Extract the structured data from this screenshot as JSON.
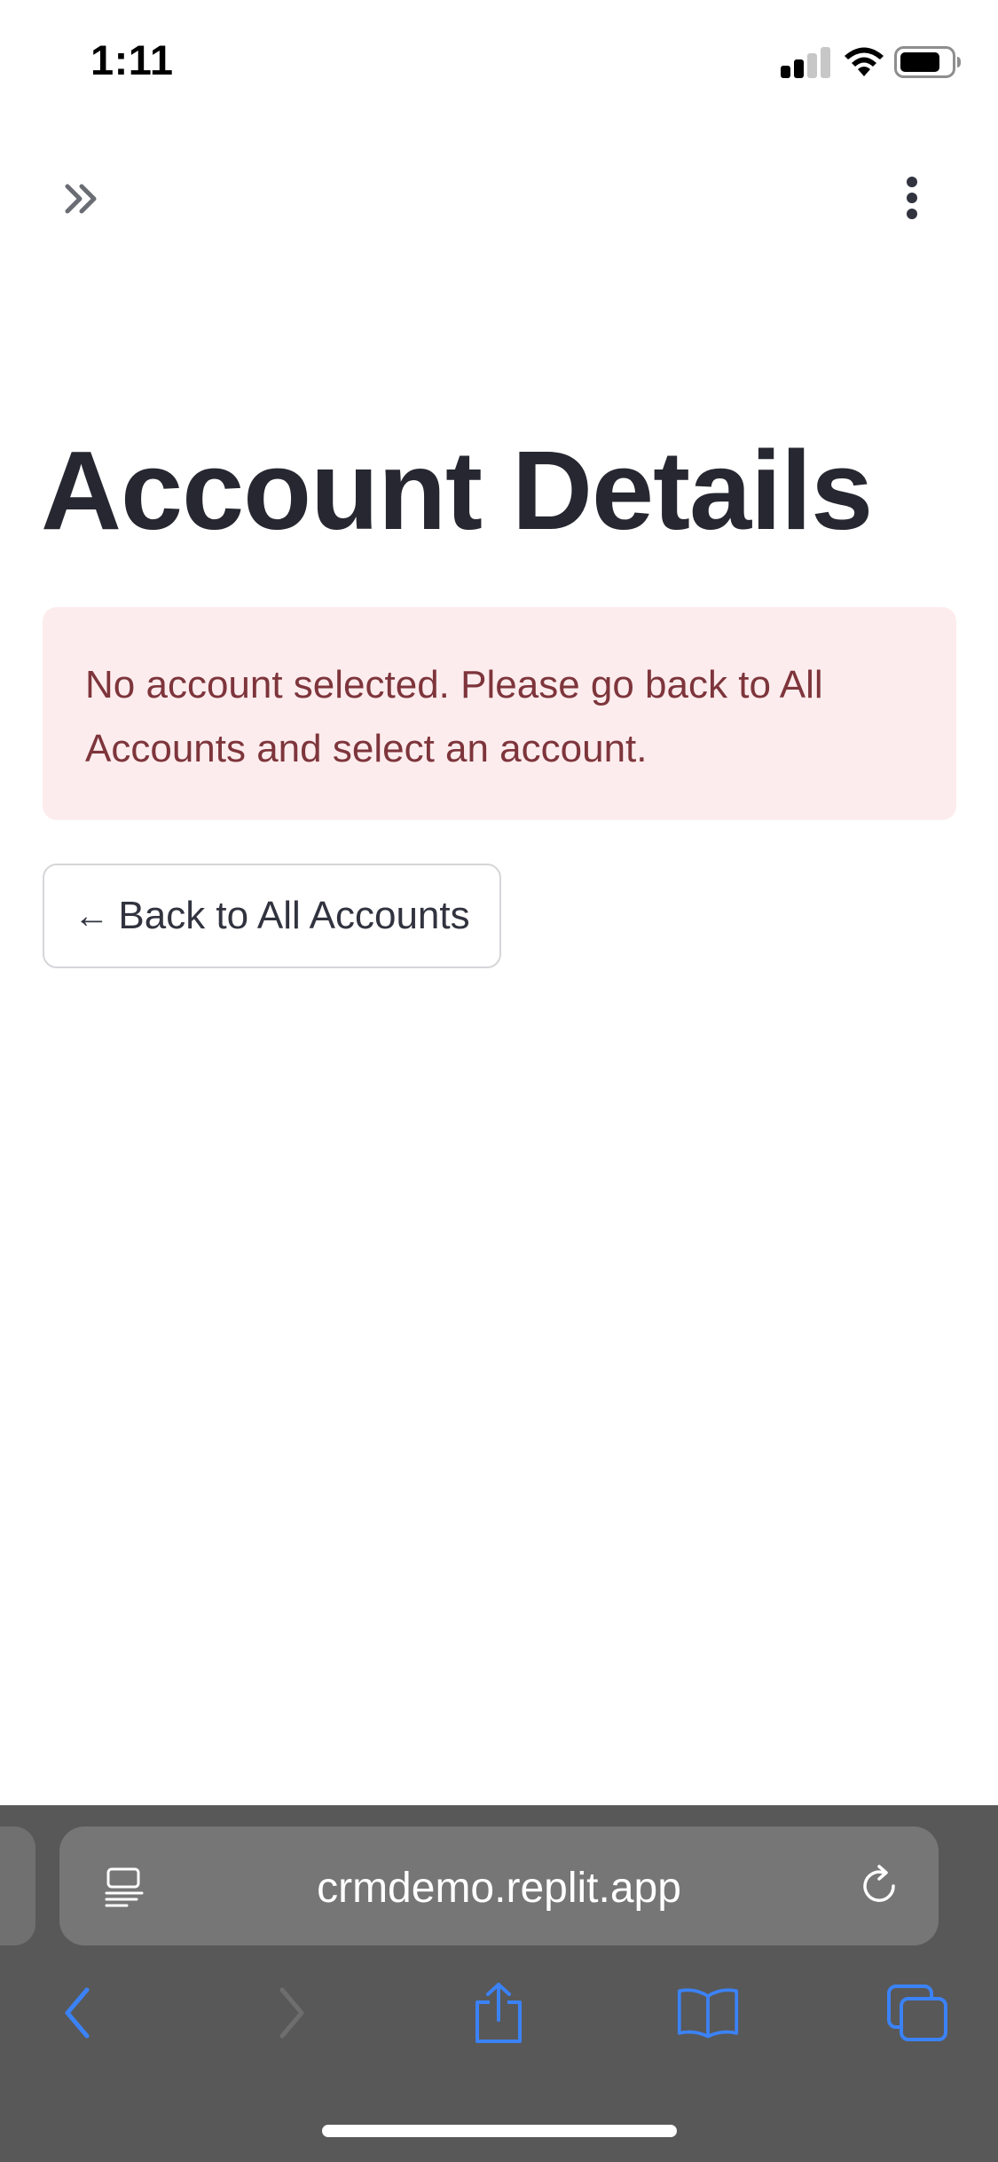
{
  "status_bar": {
    "time": "1:11",
    "icons": [
      "cellular-signal-icon",
      "wifi-icon",
      "battery-icon"
    ]
  },
  "header": {
    "sidebar_toggle_icon": "double-chevron-right-icon",
    "menu_icon": "vertical-ellipsis-icon"
  },
  "main": {
    "title": "Account Details",
    "alert": {
      "text": "No account selected. Please go back to All Accounts and select an account.",
      "background": "#fdeced",
      "text_color": "#7d353b"
    },
    "back_button": {
      "arrow": "←",
      "label": "Back to All Accounts"
    }
  },
  "browser": {
    "url": "crmdemo.replit.app",
    "toolbar_icons": [
      "back-icon",
      "forward-icon",
      "share-icon",
      "bookmarks-icon",
      "tabs-icon"
    ],
    "accent": "#3b82f6",
    "bar_color": "#585858"
  }
}
